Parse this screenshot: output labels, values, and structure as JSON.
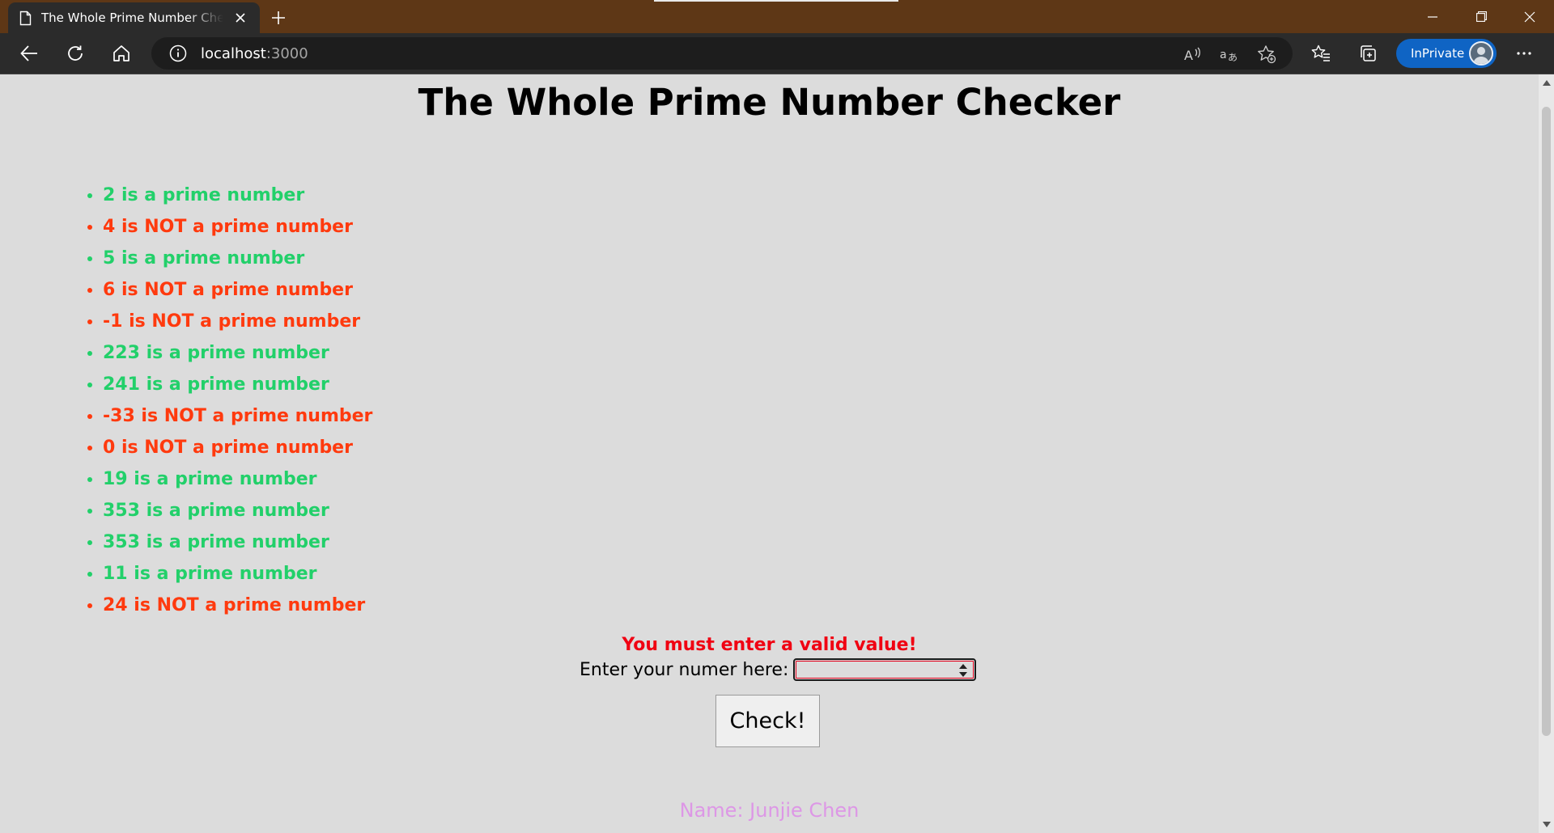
{
  "browser": {
    "tab_title": "The Whole Prime Number Checker",
    "url_host": "localhost",
    "url_port": ":3000",
    "inprivate_label": "InPrivate"
  },
  "page": {
    "title": "The Whole Prime Number Checker",
    "results": [
      {
        "text": "2 is a prime number",
        "prime": true
      },
      {
        "text": "4 is NOT a prime number",
        "prime": false
      },
      {
        "text": "5 is a prime number",
        "prime": true
      },
      {
        "text": "6 is NOT a prime number",
        "prime": false
      },
      {
        "text": "-1 is NOT a prime number",
        "prime": false
      },
      {
        "text": "223 is a prime number",
        "prime": true
      },
      {
        "text": "241 is a prime number",
        "prime": true
      },
      {
        "text": "-33 is NOT a prime number",
        "prime": false
      },
      {
        "text": "0 is NOT a prime number",
        "prime": false
      },
      {
        "text": "19 is a prime number",
        "prime": true
      },
      {
        "text": "353 is a prime number",
        "prime": true
      },
      {
        "text": "353 is a prime number",
        "prime": true
      },
      {
        "text": "11 is a prime number",
        "prime": true
      },
      {
        "text": "24 is NOT a prime number",
        "prime": false
      }
    ],
    "error_message": "You must enter a valid value!",
    "input_label": "Enter your numer here:",
    "input_value": "",
    "check_button": "Check!",
    "footer": "Name: Junjie Chen"
  },
  "colors": {
    "prime": "#22d06a",
    "not_prime": "#ff3a0e",
    "error": "#f00012",
    "footer": "#dd97e6",
    "titlebar": "#5e3716",
    "inprivate": "#0f64c4"
  }
}
